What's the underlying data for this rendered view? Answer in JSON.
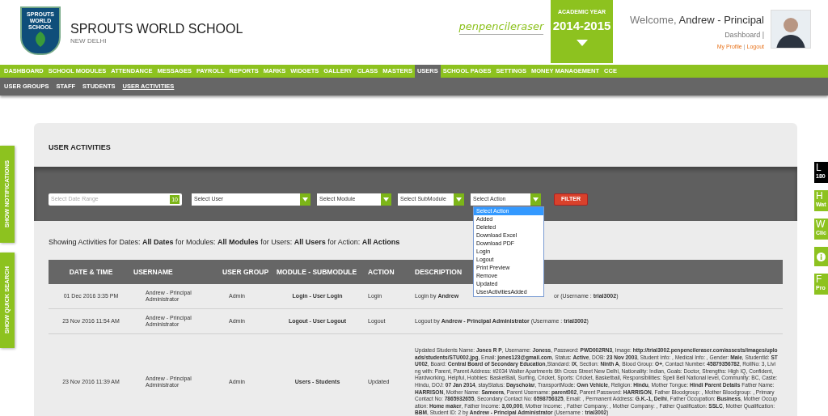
{
  "school": {
    "logo_text": "SPROUTS WORLD SCHOOL",
    "name": "SPROUTS WORLD SCHOOL",
    "city": "NEW DELHI"
  },
  "brand": {
    "text": "penpencileraser"
  },
  "academic_year": {
    "label": "ACADEMIC YEAR",
    "value": "2014-2015"
  },
  "user": {
    "welcome": "Welcome, **Andrew - Principal**",
    "dashboard": "Dashboard |",
    "profile": "My Profile",
    "separator": "|",
    "logout": "Logout"
  },
  "nav": [
    {
      "label": "DASHBOARD",
      "selected": false
    },
    {
      "label": "SCHOOL MODULES",
      "selected": false
    },
    {
      "label": "ATTENDANCE",
      "selected": false
    },
    {
      "label": "MESSAGES",
      "selected": false
    },
    {
      "label": "PAYROLL",
      "selected": false
    },
    {
      "label": "REPORTS",
      "selected": false
    },
    {
      "label": "MARKS",
      "selected": false
    },
    {
      "label": "WIDGETS",
      "selected": false
    },
    {
      "label": "GALLERY",
      "selected": false
    },
    {
      "label": "CLASS",
      "selected": false
    },
    {
      "label": "MASTERS",
      "selected": false
    },
    {
      "label": "USERS",
      "selected": true
    },
    {
      "label": "SCHOOL PAGES",
      "selected": false
    },
    {
      "label": "SETTINGS",
      "selected": false
    },
    {
      "label": "MONEY MANAGEMENT",
      "selected": false
    },
    {
      "label": "CCE",
      "selected": false
    }
  ],
  "subnav": [
    {
      "label": "USER GROUPS",
      "selected": false
    },
    {
      "label": "STAFF",
      "selected": false
    },
    {
      "label": "STUDENTS",
      "selected": false
    },
    {
      "label": "USER ACTIVITIES",
      "selected": true
    }
  ],
  "side_tabs": [
    "SHOW NOTIFICATIONS",
    "SHOW QUICK SEARCH"
  ],
  "right_tabs": [
    {
      "kind": "letter",
      "letter": "L",
      "sub": "180",
      "selected": true
    },
    {
      "kind": "letter",
      "letter": "H",
      "sub": "Wat",
      "selected": false
    },
    {
      "kind": "letter",
      "letter": "W",
      "sub": "Clic",
      "selected": false
    },
    {
      "kind": "info",
      "selected": false
    },
    {
      "kind": "letter",
      "letter": "F",
      "sub": "Pro",
      "selected": false
    }
  ],
  "panel": {
    "title": "USER ACTIVITIES"
  },
  "filters": {
    "date_placeholder": "Select Date Range",
    "date_icon": "10",
    "selects": [
      "Select User",
      "Select Module",
      "Select SubModule",
      "Select Action"
    ],
    "button": "FILTER"
  },
  "action_dropdown": [
    {
      "label": "Select Action",
      "selected": true
    },
    {
      "label": "Added",
      "selected": false
    },
    {
      "label": "Deleted",
      "selected": false
    },
    {
      "label": "Download Excel",
      "selected": false
    },
    {
      "label": "Download PDF",
      "selected": false
    },
    {
      "label": "Login",
      "selected": false
    },
    {
      "label": "Logout",
      "selected": false
    },
    {
      "label": "Print Preview",
      "selected": false
    },
    {
      "label": "Remove",
      "selected": false
    },
    {
      "label": "Updated",
      "selected": false
    },
    {
      "label": "UserActivitiesAdded",
      "selected": false
    }
  ],
  "summary": "Showing Activities for Dates: **All Dates** for Modules: **All Modules** for Users: **All Users** for Action: **All Actions**",
  "table": {
    "columns": [
      "DATE & TIME",
      "USERNAME",
      "USER GROUP",
      "MODULE - SUBMODULE",
      "ACTION",
      "DESCRIPTION"
    ],
    "rows": [
      {
        "date": "01 Dec 2016 3:35 PM",
        "username": "Andrew - Principal Administrator",
        "group": "Admin",
        "module": "Login - User Login",
        "action": "Login",
        "description": [
          "Login by **Andrew**",
          "or (Username : **trial3002**)"
        ]
      },
      {
        "date": "23 Nov 2016 11:54 AM",
        "username": "Andrew - Principal Administrator",
        "group": "Admin",
        "module": "Logout - User Logout",
        "action": "Logout",
        "description": [
          "Logout by **Andrew - Principal Administrator** (Username : **trial3002**)"
        ]
      },
      {
        "date": "23 Nov 2016 11:39 AM",
        "username": "Andrew - Principal Administrator",
        "group": "Admin",
        "module": "Users - Students",
        "action": "Updated",
        "description": [
          "Updated Students Name: **Jones R P**, Username: **Joness**, Password: **PWD002RN3**, Image: **http://trial3002.penpencileraser.com/assests/images/uploads/students/STU002.jpg**, Email: **jones123@gmail.com**, Status: **Active**, DOB: **23 Nov 2003**, Student Info: , Medical Info: , Gender: **Male**, StudentId: **STU002**, Board: **Central Board of Secondary Education**,Standard: **IX**, Section: **Ninth A**, Blood Group: **O+**, Contact Number: **45879356782**, RollNo: 3, Living with: Parent, Parent Address: #2034 Walter Apartments 6th Cross Street New Delhi, Nationality: Indian, Goals: Doctor, Strengths: High IQ, Confident, Hardworking, Helpful, Hobbies: BasketBall, Surfing, Cricket, Sports: Cricket, Basketball, Responsibilities: Spell Bell National level, Community: BC, Caste: Hindu, DOJ: **07 Jan 2014**, stayStatus: **Dayscholar**, TransportMode: **Own Vehicle**, Religion: **Hindu**, Mother Tongue: **Hindi Parent Details** Father Name: **HARRISON**, Mother Name: **Sameera**, Parent Username: **parent002**, Parent Password: **HARRISON**, Father Bloodgroup: , Mother Bloodgroup: , Primary Contact No: **7865932655**, Secondary Contact No: **6598756325**, Email: , Permanent Address: **G.K.-1, Delhi**, Father Occupation: **Business**, Mother Occupation: **Home maker**, Father Income: **3,00,000**, Mother Income: , Father Company: , Mother Company: , Father Qualification: **SSLC**, Mother Qualification: **BBM**, Student ID: 2 by **Andrew - Principal Administrator** (Username : **trial3002**)"
        ]
      }
    ]
  }
}
